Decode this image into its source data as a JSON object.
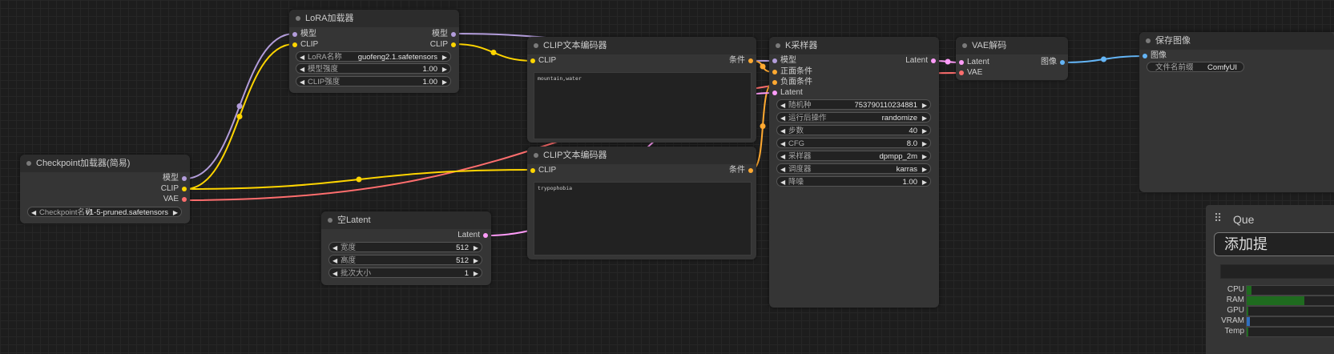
{
  "nodes": {
    "lora": {
      "title": "LoRA加载器",
      "inputs": [
        "模型",
        "CLIP"
      ],
      "outputs": [
        "模型",
        "CLIP"
      ],
      "widgets": [
        {
          "name": "LoRA名称",
          "value": "guofeng2.1.safetensors"
        },
        {
          "name": "模型强度",
          "value": "1.00"
        },
        {
          "name": "CLIP强度",
          "value": "1.00"
        }
      ]
    },
    "checkpoint": {
      "title": "Checkpoint加载器(简易)",
      "outputs": [
        "模型",
        "CLIP",
        "VAE"
      ],
      "widgets": [
        {
          "name": "Checkpoint名称",
          "value": "v1-5-pruned.safetensors"
        }
      ]
    },
    "clip_pos": {
      "title": "CLIP文本编码器",
      "input": "CLIP",
      "output": "条件",
      "text": "mountain,water"
    },
    "clip_neg": {
      "title": "CLIP文本编码器",
      "input": "CLIP",
      "output": "条件",
      "text": "trypophobia"
    },
    "latent": {
      "title": "空Latent",
      "output": "Latent",
      "widgets": [
        {
          "name": "宽度",
          "value": "512"
        },
        {
          "name": "高度",
          "value": "512"
        },
        {
          "name": "批次大小",
          "value": "1"
        }
      ]
    },
    "ksampler": {
      "title": "K采样器",
      "inputs": [
        "模型",
        "正面条件",
        "负面条件",
        "Latent"
      ],
      "output": "Latent",
      "widgets": [
        {
          "name": "随机种",
          "value": "753790110234881"
        },
        {
          "name": "运行后操作",
          "value": "randomize"
        },
        {
          "name": "步数",
          "value": "40"
        },
        {
          "name": "CFG",
          "value": "8.0"
        },
        {
          "name": "采样器",
          "value": "dpmpp_2m"
        },
        {
          "name": "调度器",
          "value": "karras"
        },
        {
          "name": "降噪",
          "value": "1.00"
        }
      ]
    },
    "vae_decode": {
      "title": "VAE解码",
      "inputs": [
        "Latent",
        "VAE"
      ],
      "output": "图像"
    },
    "save_image": {
      "title": "保存图像",
      "input": "图像",
      "widgets": [
        {
          "name": "文件名前缀",
          "value": "ComfyUI"
        }
      ]
    }
  },
  "queue_panel": {
    "title": "Que",
    "add_button": "添加提",
    "monitors": [
      {
        "label": "CPU",
        "fill": 0.05,
        "color": "#1f6b1f"
      },
      {
        "label": "RAM",
        "fill": 0.6,
        "color": "#1f6b1f"
      },
      {
        "label": "GPU",
        "fill": 0.0,
        "color": "#1f6b1f"
      },
      {
        "label": "VRAM",
        "fill": 0.03,
        "color": "#2f6fbf"
      },
      {
        "label": "Temp",
        "fill": 0.0,
        "color": "#1f6b1f"
      }
    ]
  },
  "colors": {
    "model": "#b39ddb",
    "clip": "#ffd500",
    "vae": "#ff6e6e",
    "conditioning": "#ffa931",
    "latent": "#ff9cf9",
    "image": "#64b5f6",
    "canvas": "#1d1d1d",
    "node": "#353535"
  }
}
